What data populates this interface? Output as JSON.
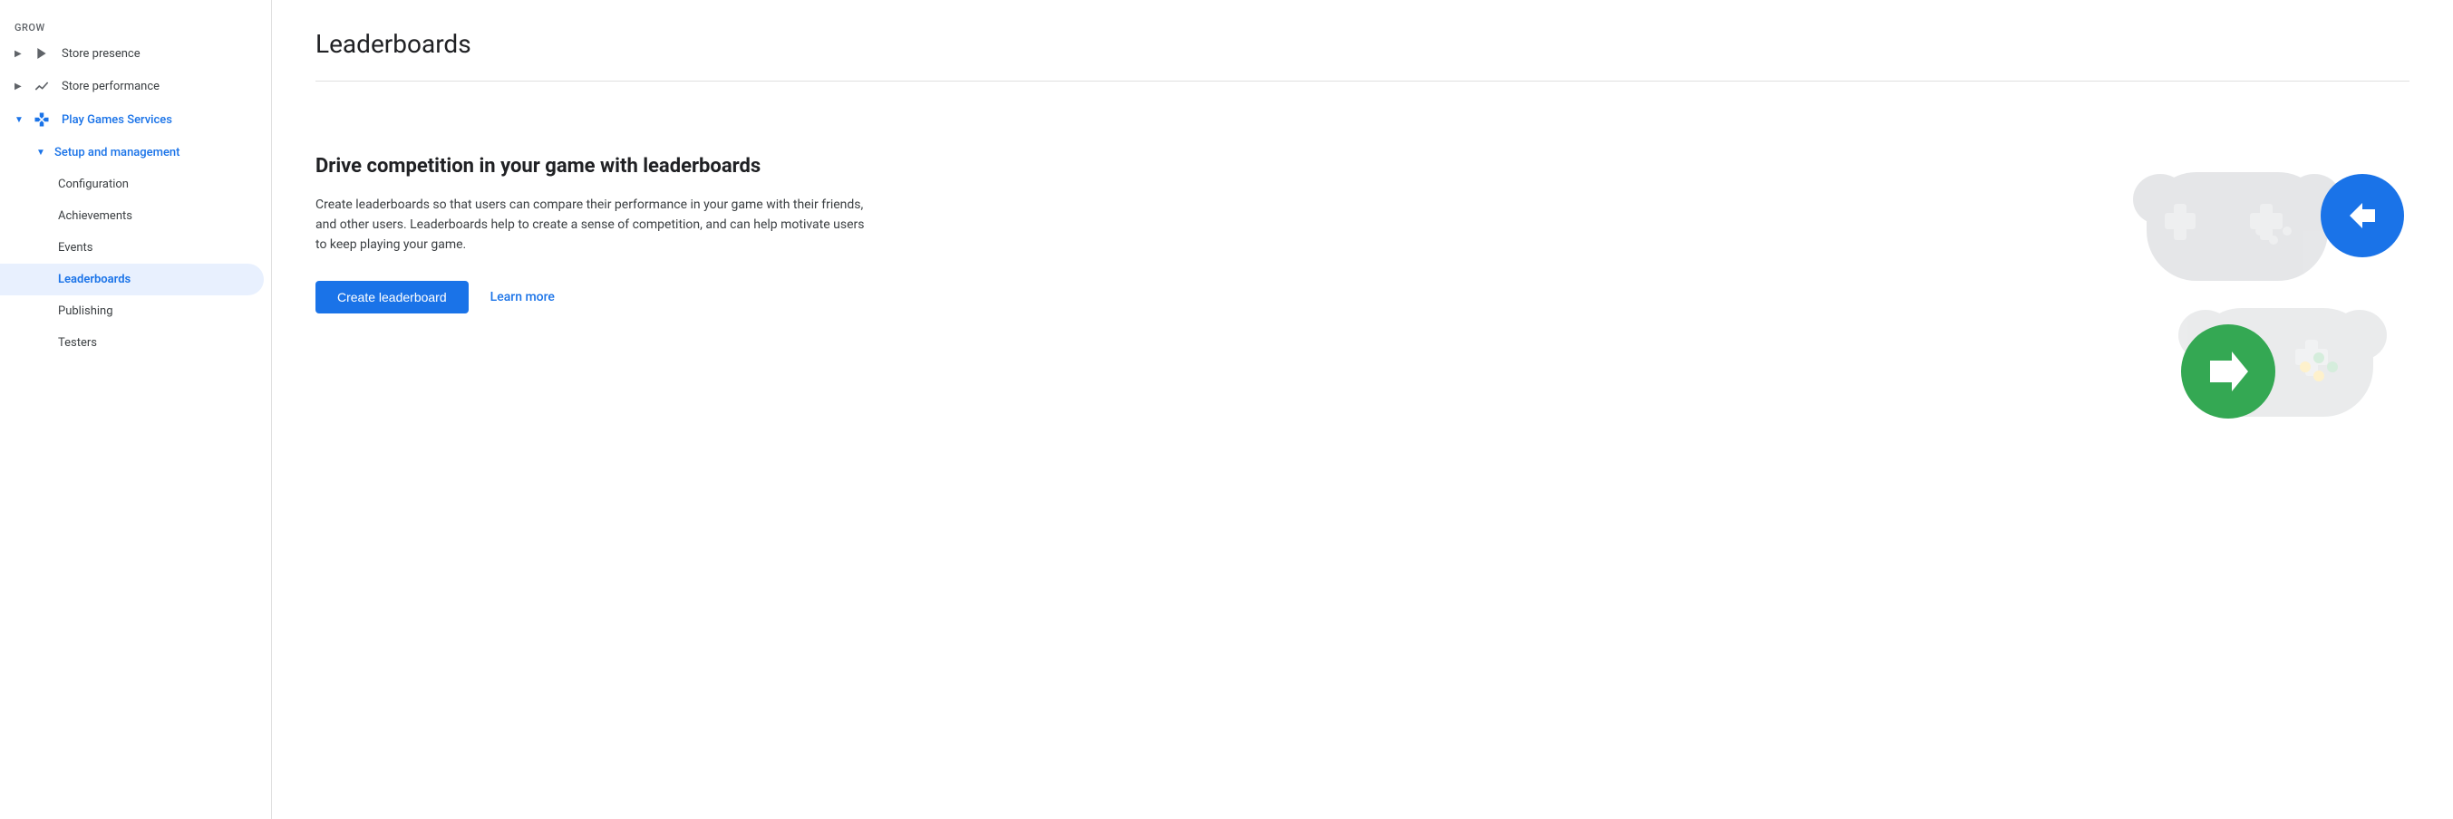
{
  "sidebar": {
    "grow_label": "Grow",
    "items": [
      {
        "id": "store-presence",
        "label": "Store presence",
        "icon": "play-triangle-icon",
        "chevron": "▶",
        "level": 0,
        "active": false,
        "blue": false
      },
      {
        "id": "store-performance",
        "label": "Store performance",
        "icon": "trending-up-icon",
        "chevron": "▶",
        "level": 0,
        "active": false,
        "blue": false
      },
      {
        "id": "play-games-services",
        "label": "Play Games Services",
        "icon": "gamepad-icon",
        "chevron": "▼",
        "level": 0,
        "active": true,
        "blue": true
      },
      {
        "id": "setup-and-management",
        "label": "Setup and management",
        "chevron": "▼",
        "level": 1,
        "active": true,
        "blue": true
      },
      {
        "id": "configuration",
        "label": "Configuration",
        "level": 2,
        "active": false
      },
      {
        "id": "achievements",
        "label": "Achievements",
        "level": 2,
        "active": false
      },
      {
        "id": "events",
        "label": "Events",
        "level": 2,
        "active": false
      },
      {
        "id": "leaderboards",
        "label": "Leaderboards",
        "level": 2,
        "active": true
      },
      {
        "id": "publishing",
        "label": "Publishing",
        "level": 2,
        "active": false
      },
      {
        "id": "testers",
        "label": "Testers",
        "level": 2,
        "active": false
      }
    ]
  },
  "main": {
    "page_title": "Leaderboards",
    "promo_title": "Drive competition in your game with leaderboards",
    "promo_description": "Create leaderboards so that users can compare their performance in your game with their friends, and other users. Leaderboards help to create a sense of competition, and can help motivate users to keep playing your game.",
    "create_button_label": "Create leaderboard",
    "learn_more_label": "Learn more"
  },
  "colors": {
    "blue": "#1a73e8",
    "green": "#34a853",
    "yellow": "#fbbc04",
    "gray_light": "#dadce0",
    "gray_medium": "#9aa0a6",
    "sidebar_active_bg": "#e8f0fe",
    "sidebar_active_text": "#1a73e8"
  }
}
